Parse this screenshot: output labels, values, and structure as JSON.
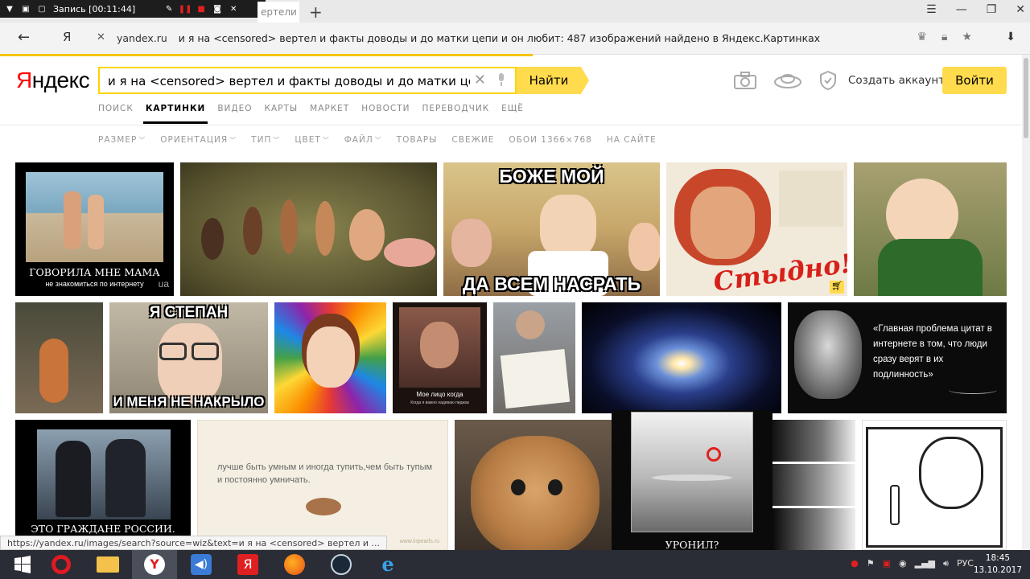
{
  "recorder": {
    "label": "Запись [00:11:44]"
  },
  "browser": {
    "active_tab_label": "ертели",
    "address": {
      "domain": "yandex.ru",
      "title": "и я на <censored> вертел и факты доводы и до матки цепи и он любит: 487 изображений найдено в Яндекс.Картинках"
    },
    "status_url": "https://yandex.ru/images/search?source=wiz&text=и я на <censored> вертел и ..."
  },
  "yandex": {
    "logo_first": "Я",
    "logo_rest": "ндекс",
    "search_value": "и я на <censored> вертел и факты доводы и до матки цепи и он любит",
    "search_button": "Найти",
    "create_account": "Создать аккаунт",
    "login": "Войти",
    "nav": [
      "ПОИСК",
      "КАРТИНКИ",
      "ВИДЕО",
      "КАРТЫ",
      "МАРКЕТ",
      "НОВОСТИ",
      "ПЕРЕВОДЧИК",
      "ЕЩЁ"
    ],
    "filters": [
      {
        "label": "РАЗМЕР",
        "dropdown": true
      },
      {
        "label": "ОРИЕНТАЦИЯ",
        "dropdown": true
      },
      {
        "label": "ТИП",
        "dropdown": true
      },
      {
        "label": "ЦВЕТ",
        "dropdown": true
      },
      {
        "label": "ФАЙЛ",
        "dropdown": true
      },
      {
        "label": "ТОВАРЫ",
        "dropdown": false
      },
      {
        "label": "СВЕЖИЕ",
        "dropdown": false
      },
      {
        "label": "ОБОИ 1366×768",
        "dropdown": false
      },
      {
        "label": "НА САЙТЕ",
        "dropdown": false
      }
    ]
  },
  "images": {
    "mama_top": "ГОВОРИЛА МНЕ МАМА",
    "mama_bottom": "не знакомиться по интернету",
    "mama_wm": "ua",
    "boje_top": "БОЖЕ МОЙ",
    "boje_bottom": "ДА ВСЕМ НАСРАТЬ",
    "stydno": "Стыдно!",
    "stepan_top": "Я СТЕПАН",
    "stepan_bottom": "И МЕНЯ НЕ НАКРЫЛО",
    "face_caption": "Мое лицо когда",
    "face_sub": "Когда я важно надеваю пиджак",
    "lenin_quote": "«Главная проблема цитат в интернете в том, что люди сразу верят в их подлинность»",
    "citizens": "ЭТО ГРАЖДАНЕ РОССИИ.",
    "smart_quote": "лучше быть умным и иногда тупить,чем быть тупым и постоянно умничать.",
    "smart_wm": "www.inpearls.ru",
    "dropped": "УРОНИЛ?"
  },
  "taskbar": {
    "lang": "РУС",
    "time": "18:45",
    "date": "13.10.2017"
  }
}
